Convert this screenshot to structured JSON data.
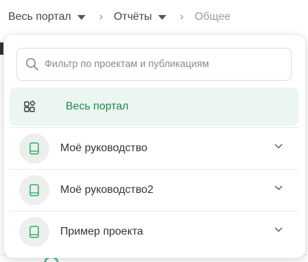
{
  "breadcrumb": {
    "portal": "Весь портал",
    "reports": "Отчёты",
    "current": "Общее",
    "separator": "›"
  },
  "dropdown": {
    "search_placeholder": "Фильтр по проектам и публикациям",
    "items": [
      {
        "label": "Весь портал",
        "icon": "portal-icon",
        "active": true
      },
      {
        "label": "Моё руководство",
        "icon": "book-icon",
        "expandable": true
      },
      {
        "label": "Моё руководство2",
        "icon": "book-icon",
        "expandable": true
      },
      {
        "label": "Пример проекта",
        "icon": "book-icon",
        "expandable": true
      }
    ]
  },
  "colors": {
    "accent": "#1e8a4e",
    "active_bg": "#eaf6ef",
    "icon_green": "#2fae62",
    "icon_circle_bg": "#ecefed"
  }
}
